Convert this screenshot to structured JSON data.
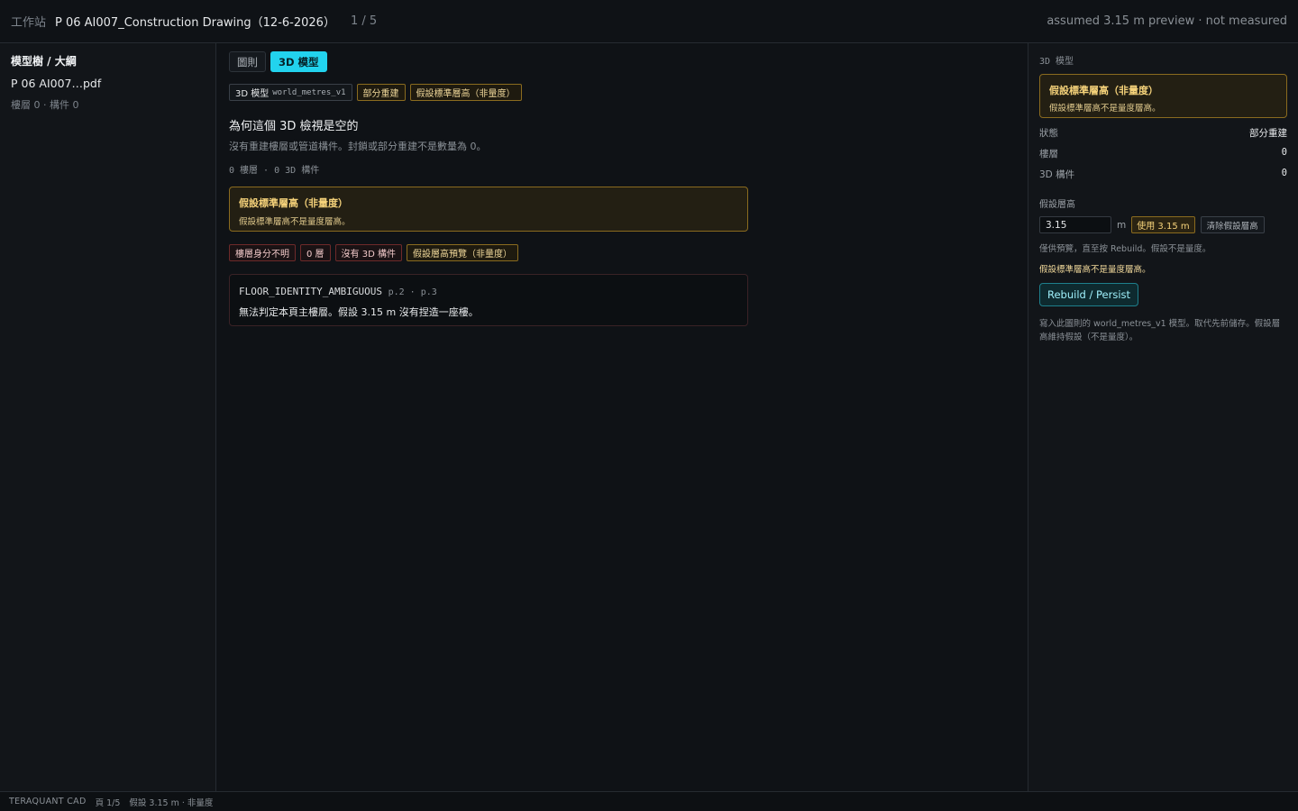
{
  "topbar": {
    "workspace_label": "工作站",
    "document_title": "P 06 AI007_Construction Drawing（12-6-2026）",
    "pager": "1 / 5",
    "preview_status": "assumed 3.15 m preview · not measured"
  },
  "sidebar": {
    "title": "模型樹 / 大綱",
    "file_name": "P 06 AI007…pdf",
    "meta": "樓層 0 · 構件 0"
  },
  "main": {
    "tabs": [
      {
        "label": "圖則",
        "active": false
      },
      {
        "label": "3D 模型",
        "active": true
      }
    ],
    "chips": {
      "model_label": "3D 模型",
      "model_sub": "world_metres_v1",
      "partial": "部分重建",
      "assumed_height": "假設標準層高（非量度）"
    },
    "empty": {
      "title": "為何這個 3D 檢視是空的",
      "subtitle": "沒有重建樓層或管道構件。封鎖或部分重建不是數量為 0。",
      "count": "0 樓層 · 0 3D 構件"
    },
    "warning": {
      "heading": "假設標準層高（非量度）",
      "body": "假設標準層高不是量度層高。"
    },
    "issue_chips": [
      "樓層身分不明",
      "0 層",
      "沒有 3D 構件",
      "假設層高預覽（非量度）"
    ],
    "issue": {
      "code": "FLOOR_IDENTITY_AMBIGUOUS",
      "pages": "p.2 · p.3",
      "message": "無法判定本頁主樓層。假設 3.15 m 沒有捏造一座樓。"
    }
  },
  "right_panel": {
    "heading": "3D 模型",
    "warning": {
      "heading": "假設標準層高（非量度）",
      "body": "假設標準層高不是量度層高。"
    },
    "status_label": "狀態",
    "status_value": "部分重建",
    "floors_label": "樓層",
    "floors_value": "0",
    "members_label": "3D 構件",
    "members_value": "0",
    "height_label": "假設層高",
    "height_value": "3.15",
    "height_unit": "m",
    "use_button": "使用 3.15 m",
    "clear_button": "清除假設層高",
    "note_preview": "僅供預覽，直至按 Rebuild。假設不是量度。",
    "note_amber": "假設標準層高不是量度層高。",
    "rebuild_button": "Rebuild / Persist",
    "description": "寫入此圖則的 world_metres_v1 模型。取代先前儲存。假設層高維持假設（不是量度）。"
  },
  "statusbar": {
    "brand": "TERAQUANT CAD",
    "page": "頁 1/5",
    "assumption": "假設 3.15 m · 非量度"
  },
  "colors": {
    "accent": "#22d3ee",
    "warning": "#f5d27a",
    "background": "#0f1216"
  }
}
